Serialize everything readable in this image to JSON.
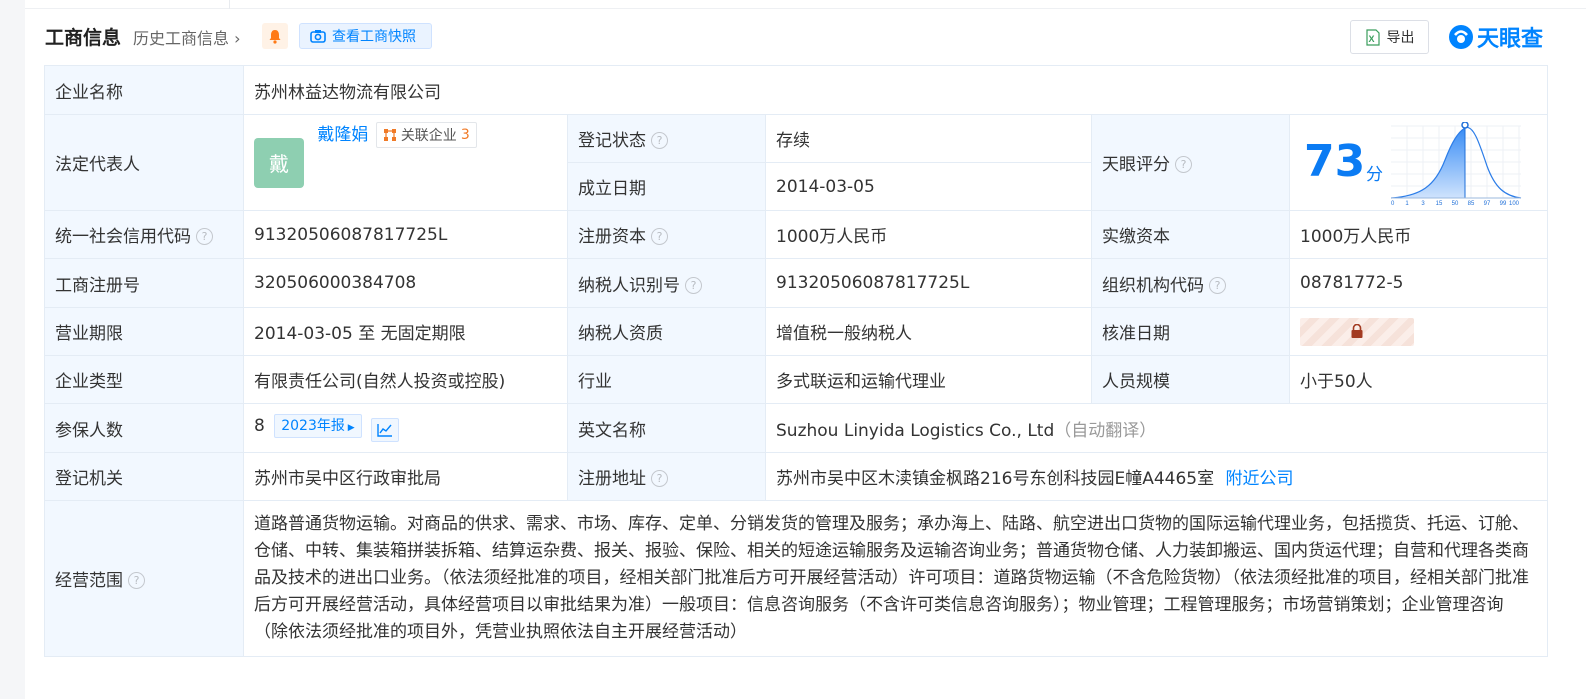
{
  "header": {
    "title": "工商信息",
    "history_link": "历史工商信息",
    "snapshot_button": "查看工商快照",
    "export_button": "导出",
    "brand": "天眼查"
  },
  "labels": {
    "company_name": "企业名称",
    "legal_rep": "法定代表人",
    "reg_status": "登记状态",
    "established": "成立日期",
    "tianyan_score": "天眼评分",
    "credit_code": "统一社会信用代码",
    "registered_capital": "注册资本",
    "paid_capital": "实缴资本",
    "biz_reg_no": "工商注册号",
    "taxpayer_id": "纳税人识别号",
    "org_code": "组织机构代码",
    "business_term": "营业期限",
    "taxpayer_qual": "纳税人资质",
    "approval_date": "核准日期",
    "company_type": "企业类型",
    "industry": "行业",
    "staff_size": "人员规模",
    "insured_count": "参保人数",
    "english_name": "英文名称",
    "reg_authority": "登记机关",
    "reg_address": "注册地址",
    "business_scope": "经营范围"
  },
  "values": {
    "company_name": "苏州林益达物流有限公司",
    "legal_rep_avatar": "戴",
    "legal_rep_name": "戴隆娟",
    "related_label": "关联企业",
    "related_count": "3",
    "reg_status": "存续",
    "established": "2014-03-05",
    "score": "73",
    "score_unit": "分",
    "credit_code": "91320506087817725L",
    "registered_capital": "1000万人民币",
    "paid_capital": "1000万人民币",
    "biz_reg_no": "320506000384708",
    "taxpayer_id": "91320506087817725L",
    "org_code": "08781772-5",
    "business_term": "2014-03-05 至 无固定期限",
    "taxpayer_qual": "增值税一般纳税人",
    "company_type": "有限责任公司(自然人投资或控股)",
    "industry": "多式联运和运输代理业",
    "staff_size": "小于50人",
    "insured_count": "8",
    "annual_report": "2023年报",
    "english_name": "Suzhou Linyida Logistics Co., Ltd",
    "english_note": "（自动翻译）",
    "reg_authority": "苏州市吴中区行政审批局",
    "reg_address": "苏州市吴中区木渎镇金枫路216号东创科技园E幢A4465室",
    "nearby_link": "附近公司",
    "business_scope": "道路普通货物运输。对商品的供求、需求、市场、库存、定单、分销发货的管理及服务；承办海上、陆路、航空进出口货物的国际运输代理业务，包括揽货、托运、订舱、仓储、中转、集装箱拼装拆箱、结算运杂费、报关、报验、保险、相关的短途运输服务及运输咨询业务；普通货物仓储、人力装卸搬运、国内货运代理；自营和代理各类商品及技术的进出口业务。（依法须经批准的项目，经相关部门批准后方可开展经营活动）许可项目：道路货物运输（不含危险货物）（依法须经批准的项目，经相关部门批准后方可开展经营活动，具体经营项目以审批结果为准）一般项目：信息咨询服务（不含许可类信息咨询服务）；物业管理；工程管理服务；市场营销策划；企业管理咨询（除依法须经批准的项目外，凭营业执照依法自主开展经营活动）"
  },
  "score_axis": {
    "ticks": [
      "0",
      "1",
      "3",
      "15",
      "50",
      "85",
      "97",
      "99",
      "100"
    ],
    "marker_percentile": 73
  },
  "colors": {
    "accent": "#0084ff",
    "label_bg": "#f2f8ff",
    "status_green": "#27a243",
    "related_count": "#f07a27"
  }
}
